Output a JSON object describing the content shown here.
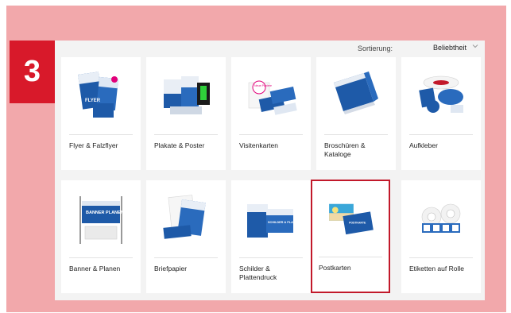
{
  "step_badge": "3",
  "sort": {
    "label": "Sortierung:",
    "value": "Beliebtheit",
    "chevron": "chevron-down-icon"
  },
  "products": [
    {
      "label": "Flyer & Falzflyer",
      "icon": "flyer-icon",
      "thumb_text": "FLYER"
    },
    {
      "label": "Plakate & Poster",
      "icon": "poster-icon",
      "thumb_text": ""
    },
    {
      "label": "Visitenkarten",
      "icon": "business-card-icon",
      "thumb_text": "Neue Papiere"
    },
    {
      "label": "Broschüren & Kataloge",
      "icon": "brochure-icon",
      "thumb_text": ""
    },
    {
      "label": "Aufkleber",
      "icon": "sticker-icon",
      "thumb_text": ""
    },
    {
      "label": "Banner & Planen",
      "icon": "banner-icon",
      "thumb_text": "BANNER PLANEN"
    },
    {
      "label": "Briefpapier",
      "icon": "letterhead-icon",
      "thumb_text": ""
    },
    {
      "label": "Schilder & Plattendruck",
      "icon": "sign-icon",
      "thumb_text": "SCHILDER & PLATTEN"
    },
    {
      "label": "Postkarten",
      "icon": "postcard-icon",
      "thumb_text": "POSTKARTE",
      "selected": true
    },
    {
      "label": "Etiketten auf Rolle",
      "icon": "label-roll-icon",
      "thumb_text": ""
    }
  ],
  "colors": {
    "background": "#f2a8ab",
    "badge": "#d8192a",
    "selected_border": "#c2192a",
    "brand_blue": "#1e5aa8"
  }
}
